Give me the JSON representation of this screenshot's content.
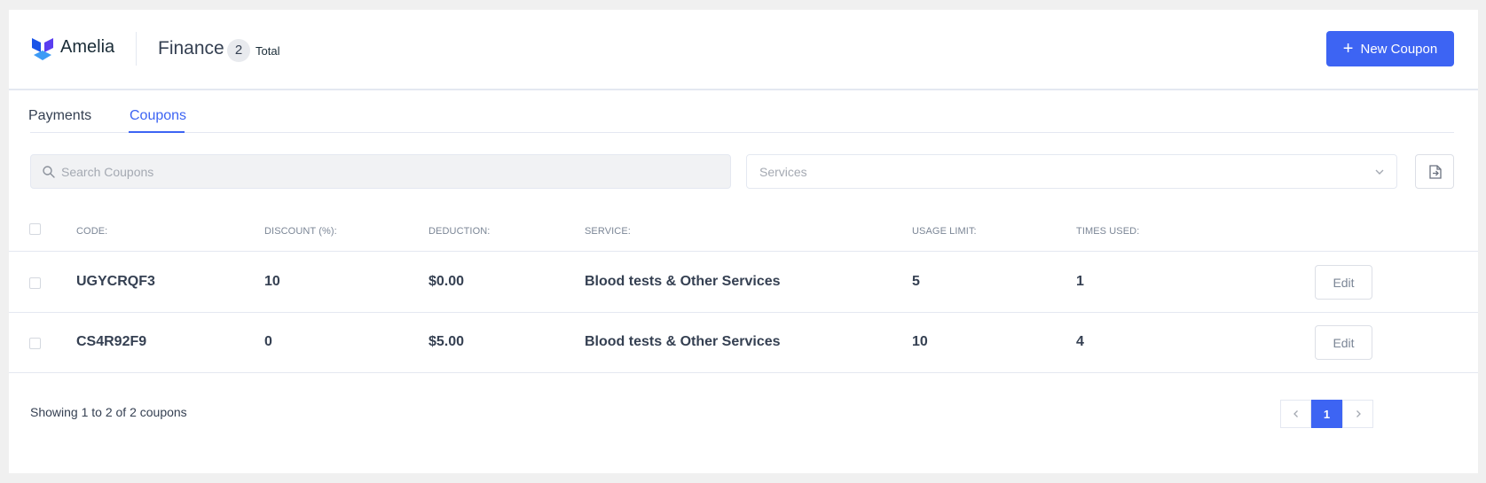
{
  "header": {
    "brand": "Amelia",
    "page_title": "Finance",
    "count": "2",
    "count_label": "Total",
    "new_button_label": "New Coupon"
  },
  "tabs": [
    {
      "label": "Payments",
      "active": false
    },
    {
      "label": "Coupons",
      "active": true
    }
  ],
  "filters": {
    "search_placeholder": "Search Coupons",
    "services_placeholder": "Services"
  },
  "table": {
    "columns": [
      "CODE:",
      "DISCOUNT (%):",
      "DEDUCTION:",
      "SERVICE:",
      "USAGE LIMIT:",
      "TIMES USED:"
    ],
    "rows": [
      {
        "code": "UGYCRQF3",
        "discount": "10",
        "deduction": "$0.00",
        "service": "Blood tests & Other Services",
        "usage_limit": "5",
        "times_used": "1",
        "action": "Edit"
      },
      {
        "code": "CS4R92F9",
        "discount": "0",
        "deduction": "$5.00",
        "service": "Blood tests & Other Services",
        "usage_limit": "10",
        "times_used": "4",
        "action": "Edit"
      }
    ]
  },
  "footer": {
    "showing_text": "Showing 1 to 2 of 2 coupons",
    "current_page": "1",
    "prev_icon": "chevron-left-icon",
    "next_icon": "chevron-right-icon"
  },
  "colors": {
    "accent": "#3d64f3",
    "text": "#354052",
    "muted": "#7b8696",
    "border": "#e4e8f1"
  }
}
